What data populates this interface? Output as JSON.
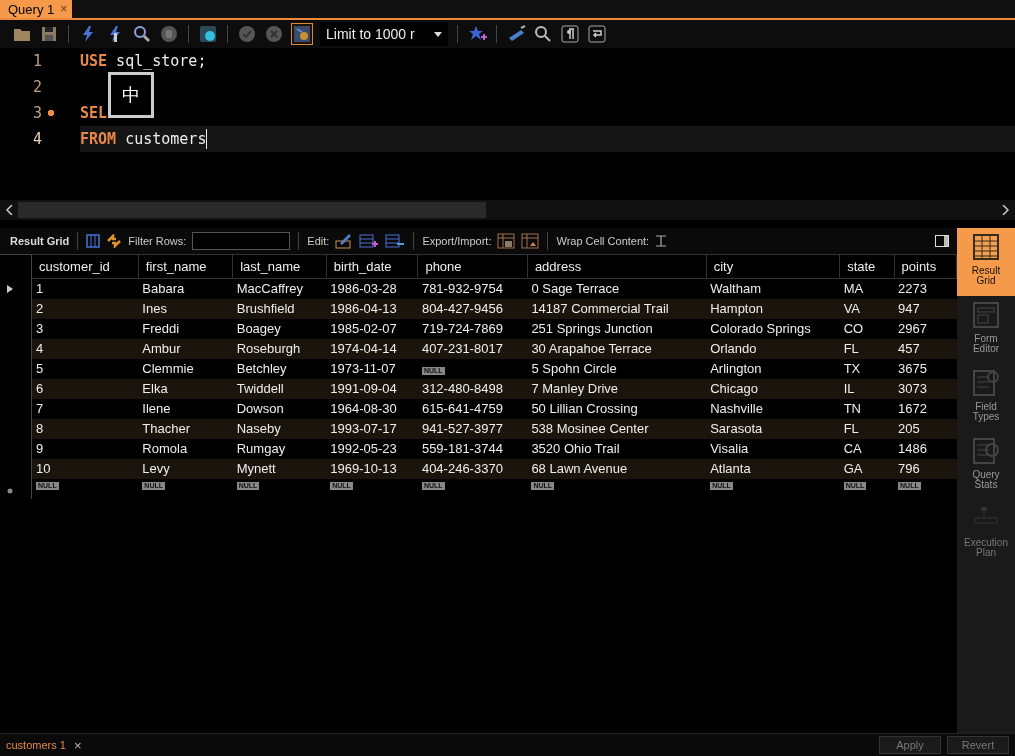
{
  "query_tab": {
    "label": "Query 1",
    "close": "×"
  },
  "toolbar": {
    "toggle_on": true,
    "limit_select": "Limit to 1000 r"
  },
  "editor": {
    "lines": [
      {
        "number": "1",
        "marker": false,
        "current": false,
        "tokens": [
          {
            "text": "USE",
            "kind": "keyword"
          },
          {
            "text": " sql_store;",
            "kind": "plain"
          }
        ]
      },
      {
        "number": "2",
        "marker": false,
        "current": false
      },
      {
        "number": "3",
        "marker": true,
        "current": false,
        "tokens": [
          {
            "text": "SEL",
            "kind": "keyword"
          }
        ]
      },
      {
        "number": "4",
        "marker": false,
        "current": true,
        "tokens": [
          {
            "text": "FROM",
            "kind": "keyword"
          },
          {
            "text": " customers",
            "kind": "plain"
          }
        ]
      }
    ],
    "ime_popup": "中"
  },
  "result_toolbar": {
    "title": "Result Grid",
    "filter_label": "Filter Rows:",
    "edit_label": "Edit:",
    "export_label": "Export/Import:",
    "wrap_label": "Wrap Cell Content:"
  },
  "grid": {
    "columns": [
      "customer_id",
      "first_name",
      "last_name",
      "birth_date",
      "phone",
      "address",
      "city",
      "state",
      "points"
    ],
    "rows": [
      {
        "kind": "data",
        "current": true,
        "cells": [
          "1",
          "Babara",
          "MacCaffrey",
          "1986-03-28",
          "781-932-9754",
          "0 Sage Terrace",
          "Waltham",
          "MA",
          "2273"
        ]
      },
      {
        "kind": "data",
        "current": false,
        "cells": [
          "2",
          "Ines",
          "Brushfield",
          "1986-04-13",
          "804-427-9456",
          "14187 Commercial Trail",
          "Hampton",
          "VA",
          "947"
        ]
      },
      {
        "kind": "data",
        "current": false,
        "cells": [
          "3",
          "Freddi",
          "Boagey",
          "1985-02-07",
          "719-724-7869",
          "251 Springs Junction",
          "Colorado Springs",
          "CO",
          "2967"
        ]
      },
      {
        "kind": "data",
        "current": false,
        "cells": [
          "4",
          "Ambur",
          "Roseburgh",
          "1974-04-14",
          "407-231-8017",
          "30 Arapahoe Terrace",
          "Orlando",
          "FL",
          "457"
        ]
      },
      {
        "kind": "data",
        "current": false,
        "cells": [
          "5",
          "Clemmie",
          "Betchley",
          "1973-11-07",
          {
            "kind": "null",
            "text": "NULL"
          },
          "5 Spohn Circle",
          "Arlington",
          "TX",
          "3675"
        ]
      },
      {
        "kind": "data",
        "current": false,
        "cells": [
          "6",
          "Elka",
          "Twiddell",
          "1991-09-04",
          "312-480-8498",
          "7 Manley Drive",
          "Chicago",
          "IL",
          "3073"
        ]
      },
      {
        "kind": "data",
        "current": false,
        "cells": [
          "7",
          "Ilene",
          "Dowson",
          "1964-08-30",
          "615-641-4759",
          "50 Lillian Crossing",
          "Nashville",
          "TN",
          "1672"
        ]
      },
      {
        "kind": "data",
        "current": false,
        "cells": [
          "8",
          "Thacher",
          "Naseby",
          "1993-07-17",
          "941-527-3977",
          "538 Mosinee Center",
          "Sarasota",
          "FL",
          "205"
        ]
      },
      {
        "kind": "data",
        "current": false,
        "cells": [
          "9",
          "Romola",
          "Rumgay",
          "1992-05-23",
          "559-181-3744",
          "3520 Ohio Trail",
          "Visalia",
          "CA",
          "1486"
        ]
      },
      {
        "kind": "data",
        "current": false,
        "cells": [
          "10",
          "Levy",
          "Mynett",
          "1969-10-13",
          "404-246-3370",
          "68 Lawn Avenue",
          "Atlanta",
          "GA",
          "796"
        ]
      },
      {
        "kind": "new",
        "current": false,
        "cells": [
          {
            "kind": "null",
            "text": "NULL"
          },
          {
            "kind": "null",
            "text": "NULL"
          },
          {
            "kind": "null",
            "text": "NULL"
          },
          {
            "kind": "null",
            "text": "NULL"
          },
          {
            "kind": "null",
            "text": "NULL"
          },
          {
            "kind": "null",
            "text": "NULL"
          },
          {
            "kind": "null",
            "text": "NULL"
          },
          {
            "kind": "null",
            "text": "NULL"
          },
          {
            "kind": "null",
            "text": "NULL"
          }
        ]
      }
    ]
  },
  "side_panel": [
    {
      "label": "Result Grid",
      "selected": true,
      "disabled": false
    },
    {
      "label": "Form Editor",
      "selected": false,
      "disabled": false
    },
    {
      "label": "Field Types",
      "selected": false,
      "disabled": false
    },
    {
      "label": "Query Stats",
      "selected": false,
      "disabled": false
    },
    {
      "label": "Execution Plan",
      "selected": false,
      "disabled": true
    }
  ],
  "bottom_bar": {
    "tab": {
      "label": "customers 1",
      "close": "×"
    },
    "buttons": [
      "Apply",
      "Revert"
    ]
  }
}
